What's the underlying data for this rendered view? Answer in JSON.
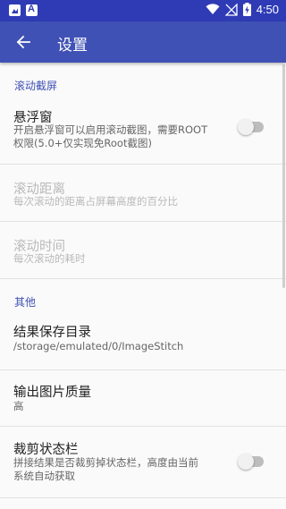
{
  "status_bar": {
    "time": "4:50",
    "icons": [
      "gallery-notification-icon",
      "text-notification-icon",
      "wifi-icon",
      "no-signal-icon",
      "battery-charging-icon"
    ]
  },
  "app_bar": {
    "title": "设置",
    "back_icon": "arrow-back-icon"
  },
  "sections": [
    {
      "header": "滚动截屏",
      "items": [
        {
          "title": "悬浮窗",
          "summary_lines": [
            "开启悬浮窗可以启用滚动截图，需要ROOT",
            "权限(5.0+仅实现免Root截图)"
          ],
          "type": "switch",
          "checked": false,
          "enabled": true
        },
        {
          "title": "滚动距离",
          "summary_lines": [
            "每次滚动的距离占屏幕高度的百分比"
          ],
          "type": "text",
          "enabled": false
        },
        {
          "title": "滚动时间",
          "summary_lines": [
            "每次滚动的耗时"
          ],
          "type": "text",
          "enabled": false
        }
      ]
    },
    {
      "header": "其他",
      "items": [
        {
          "title": "结果保存目录",
          "summary_lines": [
            "/storage/emulated/0/ImageStitch"
          ],
          "type": "text",
          "enabled": true
        },
        {
          "title": "输出图片质量",
          "summary_lines": [
            "高"
          ],
          "type": "text",
          "enabled": true
        },
        {
          "title": "裁剪状态栏",
          "summary_lines": [
            "拼接结果是否裁剪掉状态栏，高度由当前",
            "系统自动获取"
          ],
          "type": "switch",
          "checked": false,
          "enabled": true
        }
      ]
    }
  ],
  "colors": {
    "status_bar": "#2f3bb5",
    "app_bar": "#3f51b5",
    "accent_header": "#3f51b5",
    "background": "#fafafa"
  }
}
